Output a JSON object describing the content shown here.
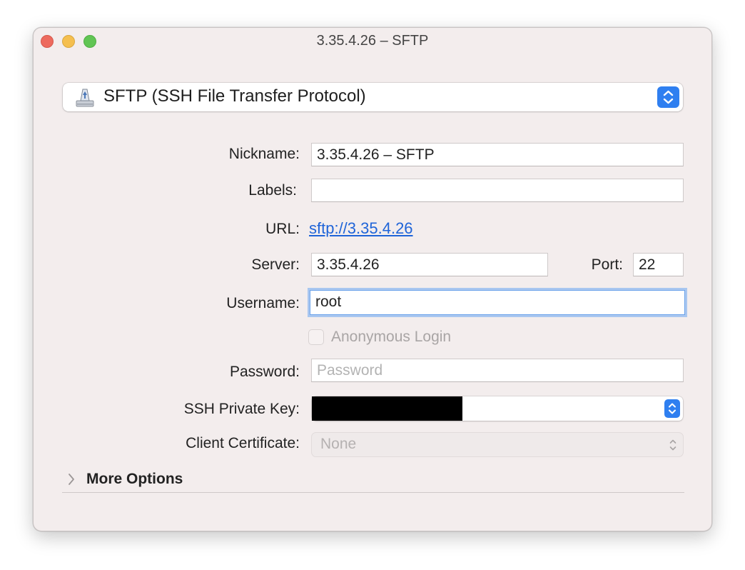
{
  "window": {
    "title": "3.35.4.26 – SFTP"
  },
  "protocol": {
    "selected": "SFTP (SSH File Transfer Protocol)",
    "icon": "network-disk-icon"
  },
  "form": {
    "nickname_label": "Nickname:",
    "nickname_value": "3.35.4.26 – SFTP",
    "labels_label": "Labels:",
    "labels_value": "",
    "url_label": "URL:",
    "url_value": "sftp://3.35.4.26",
    "server_label": "Server:",
    "server_value": "3.35.4.26",
    "port_label": "Port:",
    "port_value": "22",
    "username_label": "Username:",
    "username_value": "root",
    "anonymous_label": "Anonymous Login",
    "anonymous_checked": false,
    "password_label": "Password:",
    "password_placeholder": "Password",
    "ssh_key_label": "SSH Private Key:",
    "client_cert_label": "Client Certificate:",
    "client_cert_value": "None"
  },
  "more_options": {
    "label": "More Options",
    "expanded": false
  },
  "colors": {
    "accent": "#2f7ff0",
    "link": "#1f64d8",
    "window_bg": "#f3eded"
  }
}
